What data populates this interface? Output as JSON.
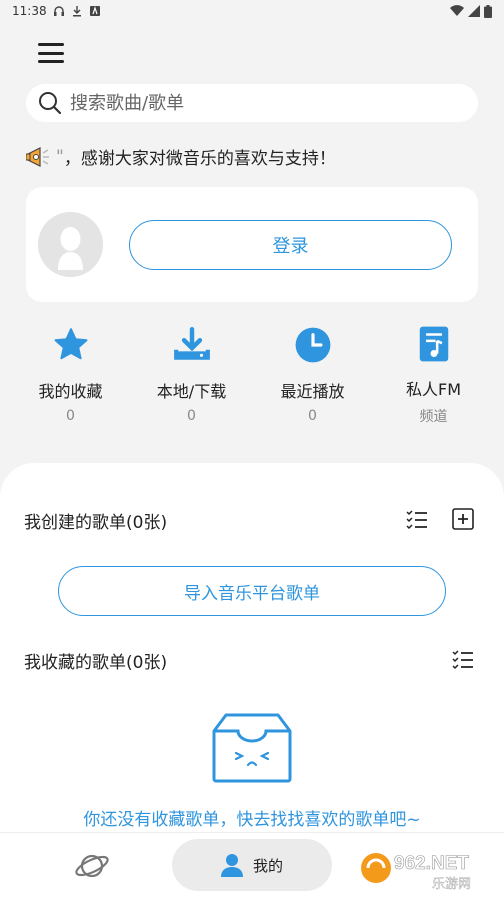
{
  "status_bar": {
    "time": "11:38"
  },
  "search": {
    "placeholder": "搜索歌曲/歌单"
  },
  "notice": {
    "quote": "\"",
    "text": "，感谢大家对微音乐的喜欢与支持！"
  },
  "login_card": {
    "login_label": "登录"
  },
  "quick_actions": [
    {
      "label": "我的收藏",
      "count": "0",
      "icon": "star-icon"
    },
    {
      "label": "本地/下载",
      "count": "0",
      "icon": "download-icon"
    },
    {
      "label": "最近播放",
      "count": "0",
      "icon": "clock-icon"
    },
    {
      "label": "私人FM",
      "count": "频道",
      "icon": "music-file-icon"
    }
  ],
  "created_playlists": {
    "title": "我创建的歌单(0张)",
    "import_label": "导入音乐平台歌单"
  },
  "collected_playlists": {
    "title": "我收藏的歌单(0张)",
    "empty_text": "你还没有收藏歌单，快去找找喜欢的歌单吧~"
  },
  "bottom_nav": {
    "mine_label": "我的"
  },
  "watermark": {
    "text_top": "962.NET",
    "text_bottom": "乐游网"
  },
  "colors": {
    "accent": "#2f95de",
    "background": "#f3f3f3"
  }
}
